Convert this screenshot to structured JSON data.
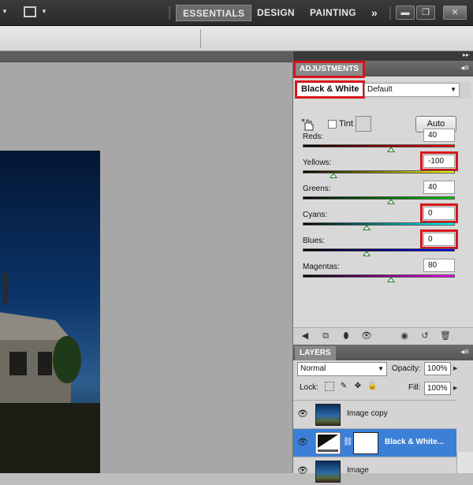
{
  "appbar": {
    "workspaces": [
      "ESSENTIALS",
      "DESIGN",
      "PAINTING"
    ],
    "more": "»"
  },
  "adjustments": {
    "tab_label": "ADJUSTMENTS",
    "panel_title": "Black & White",
    "preset": "Default",
    "tint_label": "Tint",
    "tint_checked": false,
    "auto_label": "Auto",
    "sliders": [
      {
        "label": "Reds:",
        "value": "40",
        "gradient": [
          "#000000",
          "#ff0000"
        ],
        "position": 0.58
      },
      {
        "label": "Yellows:",
        "value": "-100",
        "gradient": [
          "#000000",
          "#ffff00"
        ],
        "position": 0.2
      },
      {
        "label": "Greens:",
        "value": "40",
        "gradient": [
          "#000000",
          "#00cc00"
        ],
        "position": 0.58
      },
      {
        "label": "Cyans:",
        "value": "0",
        "gradient": [
          "#000000",
          "#00ffff"
        ],
        "position": 0.42
      },
      {
        "label": "Blues:",
        "value": "0",
        "gradient": [
          "#000000",
          "#0000ff"
        ],
        "position": 0.42
      },
      {
        "label": "Magentas:",
        "value": "80",
        "gradient": [
          "#000000",
          "#ff00ff"
        ],
        "position": 0.58
      }
    ]
  },
  "layers": {
    "tab_label": "LAYERS",
    "blend_mode": "Normal",
    "opacity_label": "Opacity:",
    "opacity": "100%",
    "lock_label": "Lock:",
    "fill_label": "Fill:",
    "fill": "100%",
    "items": [
      {
        "name": "Image copy",
        "selected": false
      },
      {
        "name": "Black & White...",
        "selected": true
      },
      {
        "name": "Image",
        "selected": false
      }
    ]
  },
  "colors": {
    "highlight_red": "#d6161c",
    "selection_blue": "#3b7fd6"
  }
}
